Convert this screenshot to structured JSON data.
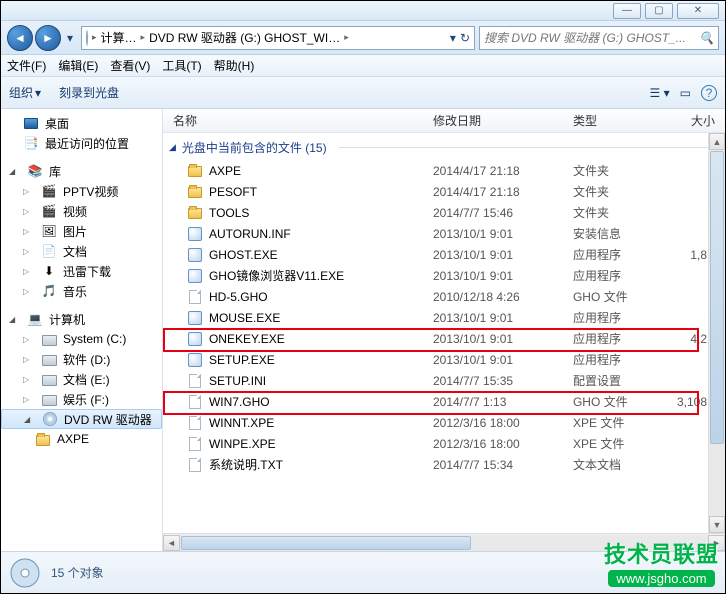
{
  "titlebar": {
    "min": "—",
    "max": "▢",
    "close": "✕"
  },
  "address": {
    "crumb1": "计算…",
    "crumb2": "DVD RW 驱动器 (G:) GHOST_WI…",
    "search_placeholder": "搜索 DVD RW 驱动器 (G:) GHOST_..."
  },
  "menu": {
    "file": "文件(F)",
    "edit": "编辑(E)",
    "view": "查看(V)",
    "tools": "工具(T)",
    "help": "帮助(H)"
  },
  "toolbar": {
    "organize": "组织",
    "burn": "刻录到光盘"
  },
  "columns": {
    "name": "名称",
    "date": "修改日期",
    "type": "类型",
    "size": "大小"
  },
  "group_title": "光盘中当前包含的文件 (15)",
  "sidebar": {
    "desktop": "桌面",
    "recent": "最近访问的位置",
    "libraries": "库",
    "pptv": "PPTV视频",
    "video": "视频",
    "pictures": "图片",
    "documents": "文档",
    "xunlei": "迅雷下载",
    "music": "音乐",
    "computer": "计算机",
    "c": "System (C:)",
    "d": "软件 (D:)",
    "e": "文档 (E:)",
    "f": "娱乐 (F:)",
    "dvd": "DVD RW 驱动器",
    "axpe": "AXPE"
  },
  "files": [
    {
      "name": "AXPE",
      "date": "2014/4/17 21:18",
      "type": "文件夹",
      "size": "",
      "icon": "folder"
    },
    {
      "name": "PESOFT",
      "date": "2014/4/17 21:18",
      "type": "文件夹",
      "size": "",
      "icon": "folder"
    },
    {
      "name": "TOOLS",
      "date": "2014/7/7 15:46",
      "type": "文件夹",
      "size": "",
      "icon": "folder"
    },
    {
      "name": "AUTORUN.INF",
      "date": "2013/10/1 9:01",
      "type": "安装信息",
      "size": "",
      "icon": "exe"
    },
    {
      "name": "GHOST.EXE",
      "date": "2013/10/1 9:01",
      "type": "应用程序",
      "size": "1,8",
      "icon": "exe"
    },
    {
      "name": "GHO镜像浏览器V11.EXE",
      "date": "2013/10/1 9:01",
      "type": "应用程序",
      "size": "",
      "icon": "exe"
    },
    {
      "name": "HD-5.GHO",
      "date": "2010/12/18 4:26",
      "type": "GHO 文件",
      "size": "",
      "icon": "file"
    },
    {
      "name": "MOUSE.EXE",
      "date": "2013/10/1 9:01",
      "type": "应用程序",
      "size": "",
      "icon": "exe"
    },
    {
      "name": "ONEKEY.EXE",
      "date": "2013/10/1 9:01",
      "type": "应用程序",
      "size": "4,2",
      "icon": "exe"
    },
    {
      "name": "SETUP.EXE",
      "date": "2013/10/1 9:01",
      "type": "应用程序",
      "size": "",
      "icon": "exe"
    },
    {
      "name": "SETUP.INI",
      "date": "2014/7/7 15:35",
      "type": "配置设置",
      "size": "",
      "icon": "file"
    },
    {
      "name": "WIN7.GHO",
      "date": "2014/7/7 1:13",
      "type": "GHO 文件",
      "size": "3,108",
      "icon": "file"
    },
    {
      "name": "WINNT.XPE",
      "date": "2012/3/16 18:00",
      "type": "XPE 文件",
      "size": "",
      "icon": "file"
    },
    {
      "name": "WINPE.XPE",
      "date": "2012/3/16 18:00",
      "type": "XPE 文件",
      "size": "",
      "icon": "file"
    },
    {
      "name": "系统说明.TXT",
      "date": "2014/7/7 15:34",
      "type": "文本文档",
      "size": "",
      "icon": "file"
    }
  ],
  "status": {
    "count": "15 个对象"
  },
  "watermark": {
    "line1": "技术员联盟",
    "line2": "www.jsgho.com"
  }
}
